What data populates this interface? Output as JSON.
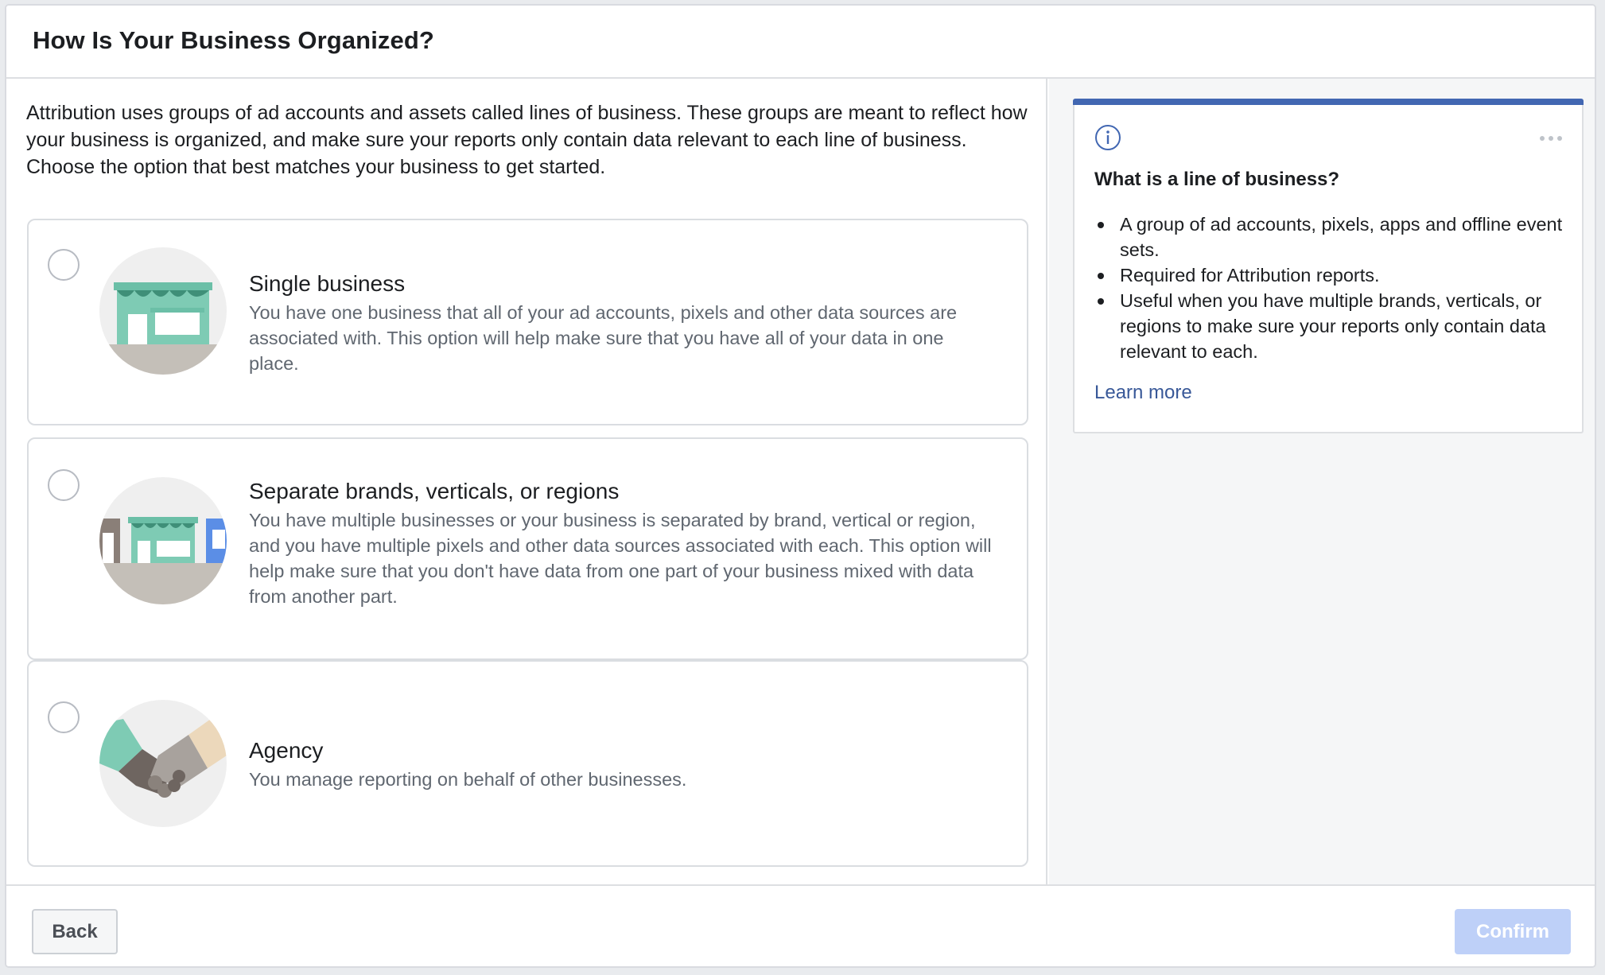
{
  "header": {
    "title": "How Is Your Business Organized?"
  },
  "intro": "Attribution uses groups of ad accounts and assets called lines of business. These groups are meant to reflect how your business is organized, and make sure your reports only contain data relevant to each line of business. Choose the option that best matches your business to get started.",
  "options": [
    {
      "title": "Single business",
      "description": "You have one business that all of your ad accounts, pixels and other data sources are associated with. This option will help make sure that you have all of your data in one place.",
      "illustration": "storefront-illustration",
      "selected": false
    },
    {
      "title": "Separate brands, verticals, or regions",
      "description": "You have multiple businesses or your business is separated by brand, vertical or region, and you have multiple pixels and other data sources associated with each. This option will help make sure that you don't have data from one part of your business mixed with data from another part.",
      "illustration": "multiple-storefronts-illustration",
      "selected": false
    },
    {
      "title": "Agency",
      "description": "You manage reporting on behalf of other businesses.",
      "illustration": "handshake-illustration",
      "selected": false
    }
  ],
  "info_card": {
    "icon": "info-icon",
    "menu_icon": "more-horizontal-icon",
    "title": "What is a line of business?",
    "bullets": [
      "A group of ad accounts, pixels, apps and offline event sets.",
      "Required for Attribution reports.",
      "Useful when you have multiple brands, verticals, or regions to make sure your reports only contain data relevant to each."
    ],
    "link": "Learn more"
  },
  "footer": {
    "back_label": "Back",
    "confirm_label": "Confirm"
  },
  "colors": {
    "accent": "#4267b2",
    "link": "#385898",
    "confirm_disabled": "#bed0f8",
    "storefront_green": "#7ecbb4"
  }
}
